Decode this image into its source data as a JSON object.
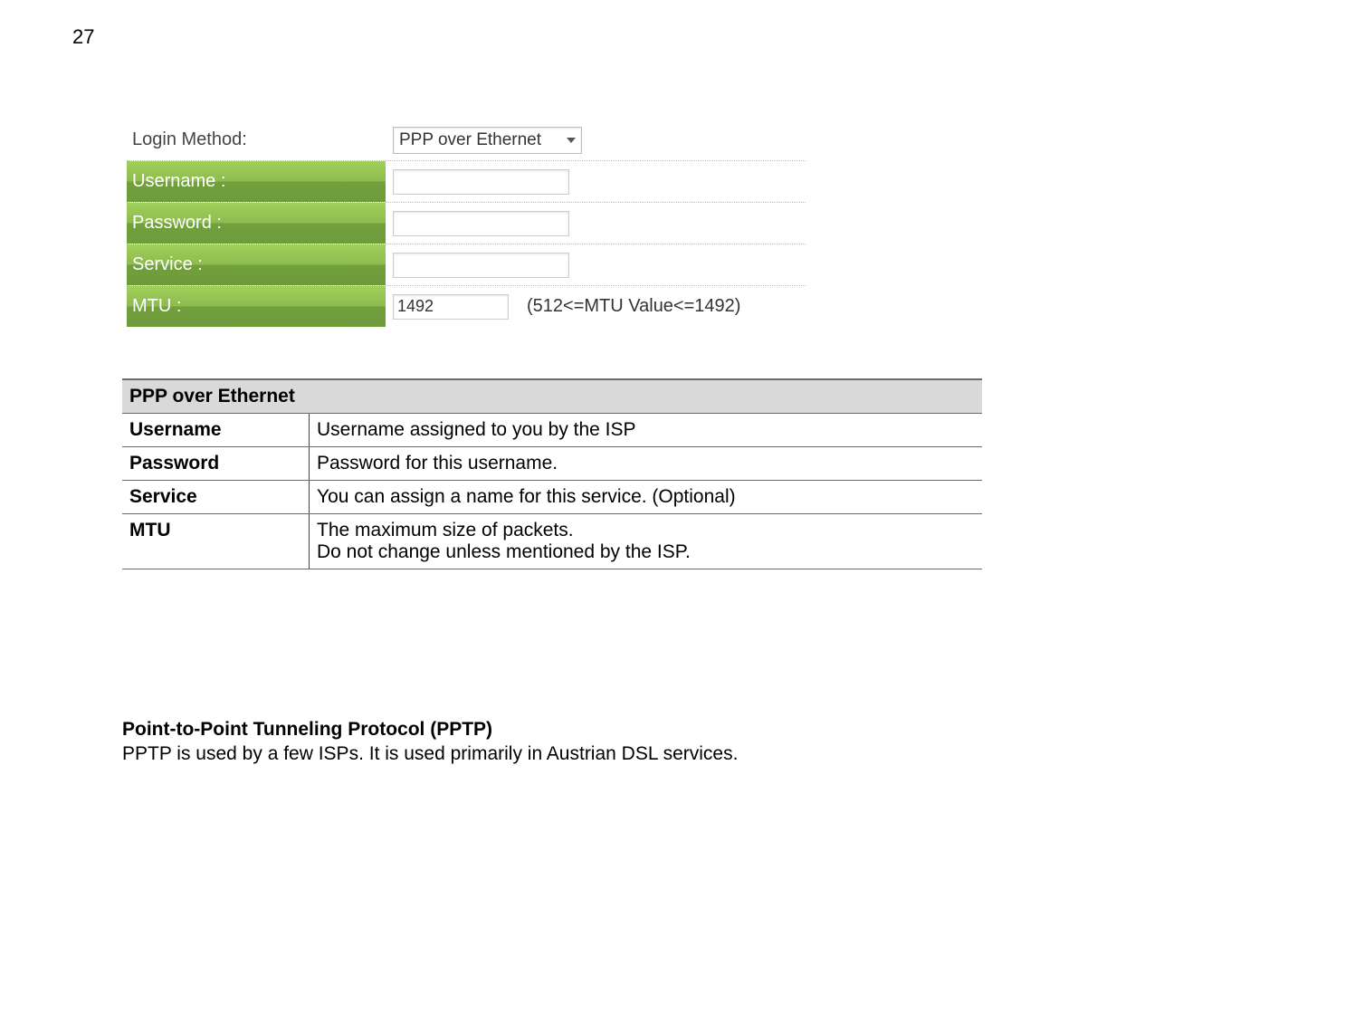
{
  "page_number": "27",
  "form": {
    "login_method_label": "Login Method:",
    "login_method_value": "PPP over Ethernet",
    "username_label": "Username :",
    "username_value": "",
    "password_label": "Password :",
    "password_value": "",
    "service_label": "Service :",
    "service_value": "",
    "mtu_label": "MTU :",
    "mtu_value": "1492",
    "mtu_hint": "(512<=MTU Value<=1492)"
  },
  "table": {
    "header": "PPP over Ethernet",
    "rows": [
      {
        "key": "Username",
        "val": "Username assigned to you by the ISP"
      },
      {
        "key": "Password",
        "val": "Password for this username."
      },
      {
        "key": "Service",
        "val": "You can assign a name for this service. (Optional)"
      },
      {
        "key": "MTU",
        "val": "The maximum size of packets.\nDo not change unless mentioned by the ISP."
      }
    ]
  },
  "bottom": {
    "title": "Point-to-Point Tunneling Protocol (PPTP)",
    "body": "PPTP is used by a few ISPs. It is used primarily in Austrian DSL services."
  }
}
